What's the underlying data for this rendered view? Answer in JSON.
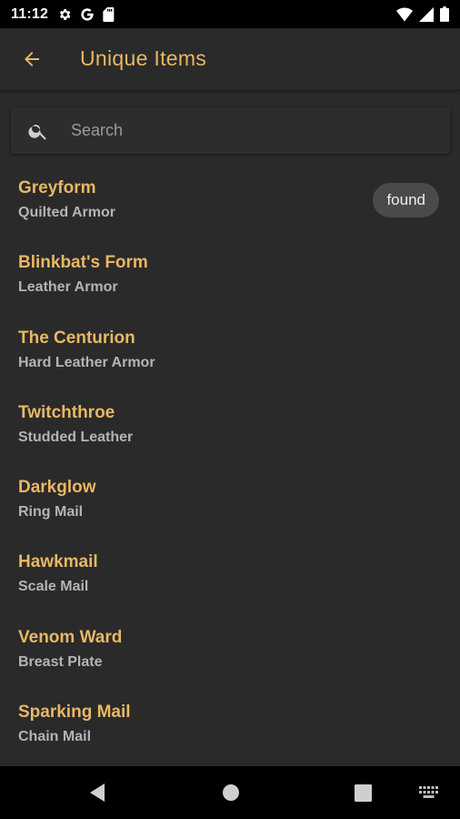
{
  "status_bar": {
    "time": "11:12",
    "left_icons": [
      "gear-icon",
      "google-icon",
      "sd-card-icon"
    ],
    "right_icons": [
      "wifi-icon",
      "signal-icon",
      "battery-icon"
    ]
  },
  "app_bar": {
    "back_icon": "arrow-back-icon",
    "title": "Unique Items"
  },
  "search": {
    "icon": "search-icon",
    "placeholder": "Search",
    "value": ""
  },
  "items": [
    {
      "name": "Greyform",
      "type": "Quilted Armor",
      "badge": "found"
    },
    {
      "name": "Blinkbat's Form",
      "type": "Leather Armor",
      "badge": null
    },
    {
      "name": "The Centurion",
      "type": "Hard Leather Armor",
      "badge": null
    },
    {
      "name": "Twitchthroe",
      "type": "Studded Leather",
      "badge": null
    },
    {
      "name": "Darkglow",
      "type": "Ring Mail",
      "badge": null
    },
    {
      "name": "Hawkmail",
      "type": "Scale Mail",
      "badge": null
    },
    {
      "name": "Venom Ward",
      "type": "Breast Plate",
      "badge": null
    },
    {
      "name": "Sparking Mail",
      "type": "Chain Mail",
      "badge": null
    }
  ],
  "nav_bar": {
    "buttons": [
      "back-triangle-icon",
      "home-circle-icon",
      "recents-square-icon",
      "keyboard-icon"
    ]
  },
  "colors": {
    "accent": "#e8b764",
    "background": "#2a2a2a",
    "secondary_text": "#b4b4b4",
    "badge_bg": "#4a4a4a"
  }
}
